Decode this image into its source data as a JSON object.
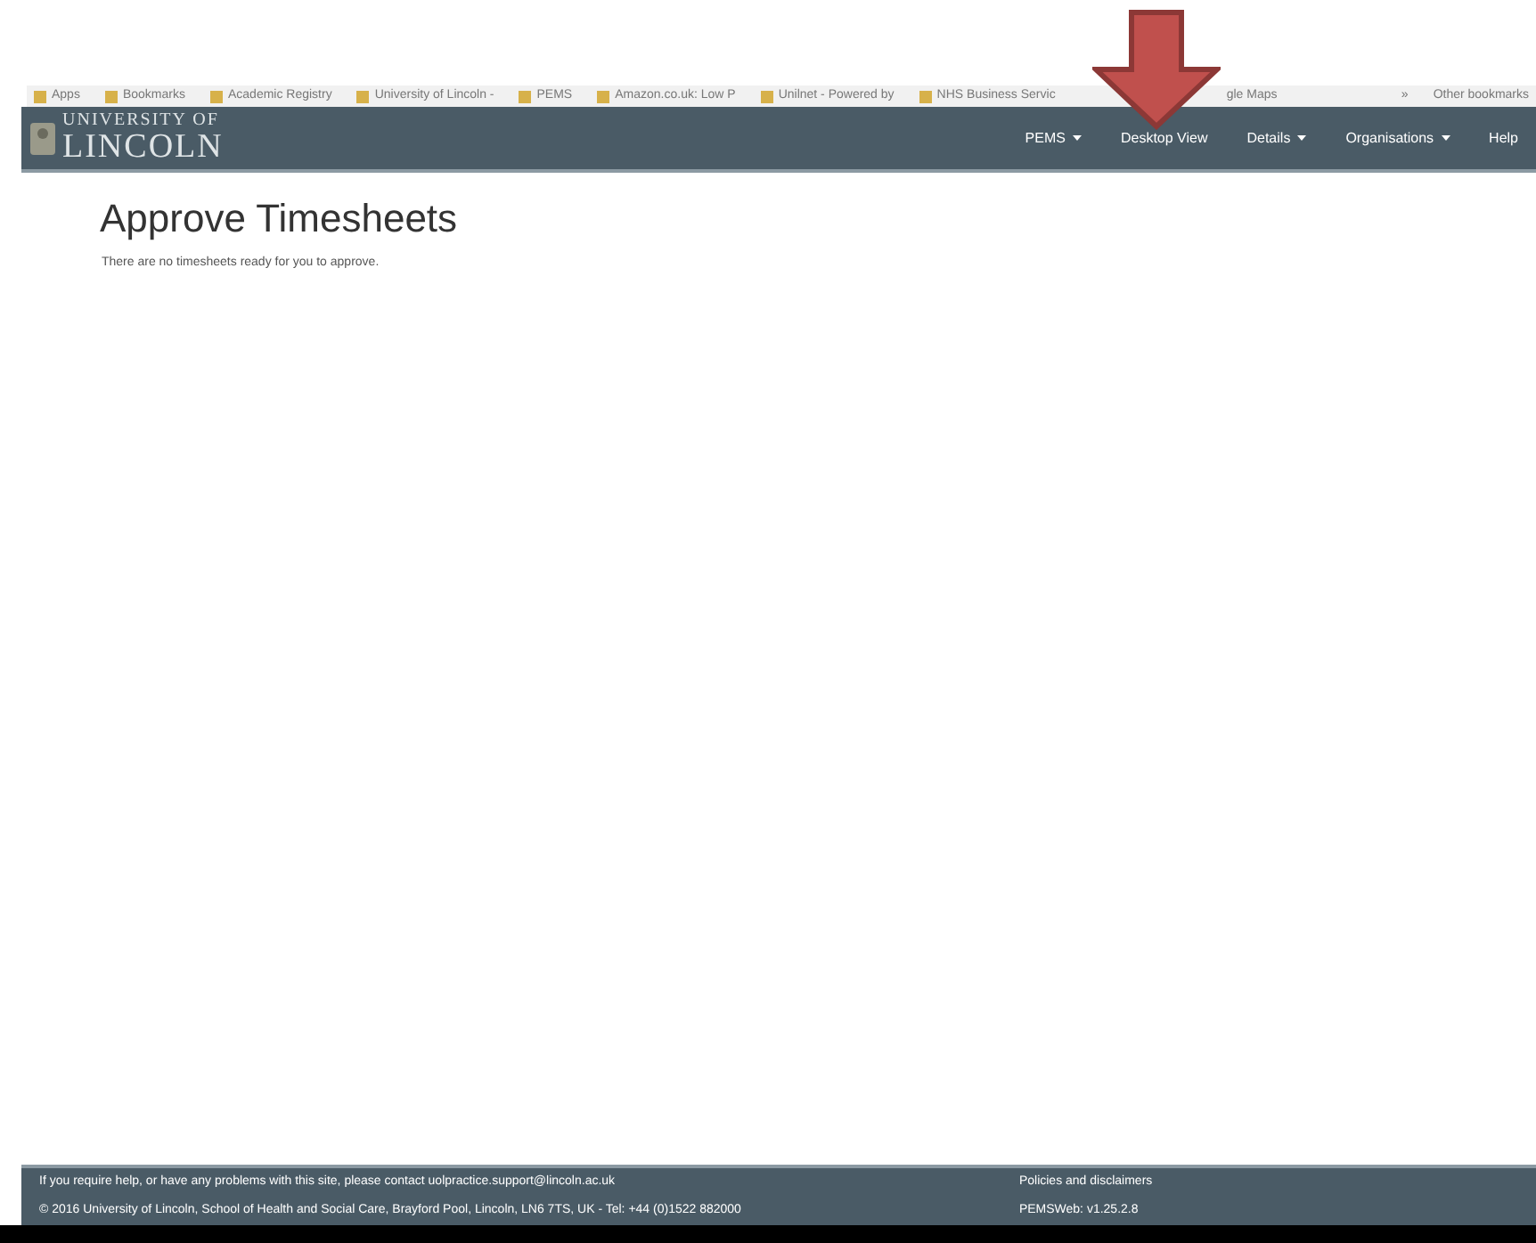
{
  "bookmarks_bar": {
    "items": [
      "Apps",
      "Bookmarks",
      "Academic Registry",
      "University of Lincoln -",
      "PEMS",
      "Amazon.co.uk: Low P",
      "Unilnet - Powered by",
      "NHS Business Servic",
      "gle Maps"
    ],
    "overflow": "»",
    "other": "Other bookmarks"
  },
  "navbar": {
    "logo_top": "UNIVERSITY OF",
    "logo_bottom": "LINCOLN",
    "items": [
      {
        "label": "PEMS",
        "dropdown": true
      },
      {
        "label": "Desktop View",
        "dropdown": false
      },
      {
        "label": "Details",
        "dropdown": true
      },
      {
        "label": "Organisations",
        "dropdown": true
      },
      {
        "label": "Help",
        "dropdown": false
      }
    ]
  },
  "page": {
    "title": "Approve Timesheets",
    "message": "There are no timesheets ready for you to approve."
  },
  "footer": {
    "help_text": "If you require help, or have any problems with this site, please contact uolpractice.support@lincoln.ac.uk",
    "copyright": "© 2016 University of Lincoln, School of Health and Social Care, Brayford Pool, Lincoln, LN6 7TS, UK - Tel: +44 (0)1522 882000",
    "policies_link": "Policies and disclaimers",
    "version": "PEMSWeb: v1.25.2.8"
  }
}
